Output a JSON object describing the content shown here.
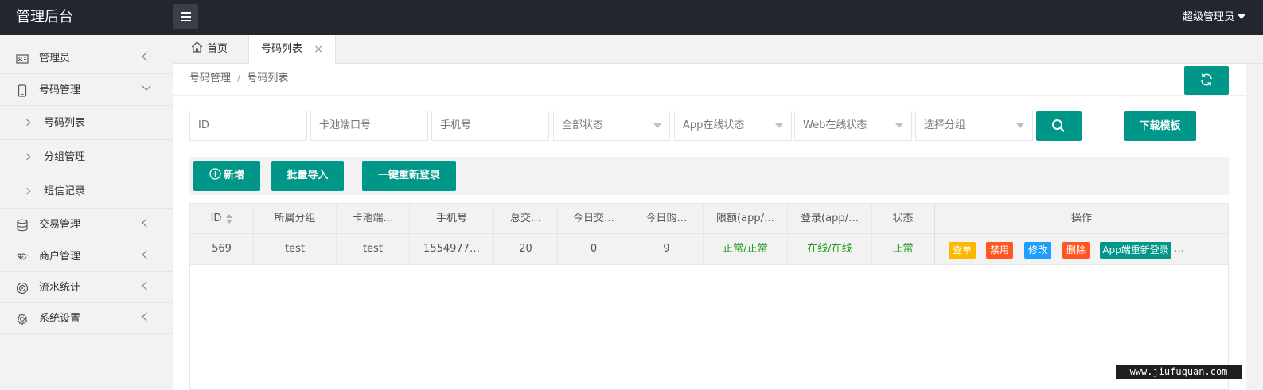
{
  "header": {
    "brand": "管理后台",
    "user": "超级管理员"
  },
  "sidebar": {
    "items": [
      {
        "label": "管理员",
        "icon": "admin-card-icon"
      },
      {
        "label": "号码管理",
        "icon": "phone-icon"
      },
      {
        "label": "交易管理",
        "icon": "database-icon"
      },
      {
        "label": "商户管理",
        "icon": "handshake-icon"
      },
      {
        "label": "流水统计",
        "icon": "target-icon"
      },
      {
        "label": "系统设置",
        "icon": "gear-icon"
      }
    ],
    "sub_items": [
      {
        "label": "号码列表"
      },
      {
        "label": "分组管理"
      },
      {
        "label": "短信记录"
      }
    ]
  },
  "tabs": {
    "home": "首页",
    "active": "号码列表",
    "close": "×"
  },
  "breadcrumb": {
    "parent": "号码管理",
    "separator": "/",
    "current": "号码列表"
  },
  "filters": {
    "id_placeholder": "ID",
    "port_placeholder": "卡池端口号",
    "phone_placeholder": "手机号",
    "status_select": "全部状态",
    "app_status_select": "App在线状态",
    "web_status_select": "Web在线状态",
    "group_select": "选择分组",
    "download_label": "下载模板"
  },
  "actions": {
    "add_label": "新增",
    "import_label": "批量导入",
    "relogin_label": "一键重新登录"
  },
  "table": {
    "columns": [
      "ID",
      "所属分组",
      "卡池端…",
      "手机号",
      "总交…",
      "今日交…",
      "今日购…",
      "限额(app/…",
      "登录(app/…",
      "状态",
      "操作"
    ],
    "rows": [
      {
        "id": "569",
        "group": "test",
        "port": "test",
        "phone": "1554977…",
        "total": "20",
        "today_trade": "0",
        "today_buy": "9",
        "limit": "正常/正常",
        "login": "在线/在线",
        "status": "正常",
        "ops": [
          "查单",
          "禁用",
          "修改",
          "删除",
          "App端重新登录"
        ],
        "more": "…"
      }
    ]
  },
  "colors": {
    "accent": "#009688",
    "topbar": "#23262e",
    "success_text": "#1e9a1e",
    "op_query": "#ffb800",
    "op_disable": "#ff5722",
    "op_edit": "#1e9fff",
    "op_delete": "#ff5722",
    "op_relogin": "#009688"
  },
  "watermark": "www.jiufuquan.com"
}
